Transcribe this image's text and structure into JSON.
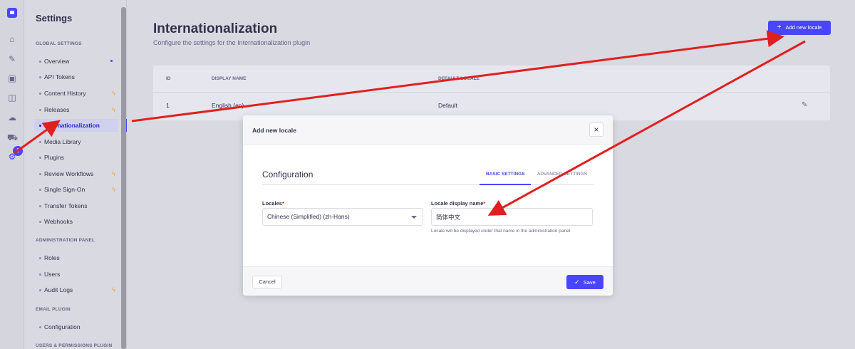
{
  "rail": {
    "badge": "1"
  },
  "sidebar": {
    "title": "Settings",
    "sections": {
      "global": "GLOBAL SETTINGS",
      "admin": "ADMINISTRATION PANEL",
      "email": "EMAIL PLUGIN",
      "users": "USERS & PERMISSIONS PLUGIN"
    },
    "global_items": [
      {
        "label": "Overview"
      },
      {
        "label": "API Tokens"
      },
      {
        "label": "Content History"
      },
      {
        "label": "Releases"
      },
      {
        "label": "Internationalization"
      },
      {
        "label": "Media Library"
      },
      {
        "label": "Plugins"
      },
      {
        "label": "Review Workflows"
      },
      {
        "label": "Single Sign-On"
      },
      {
        "label": "Transfer Tokens"
      },
      {
        "label": "Webhooks"
      }
    ],
    "admin_items": [
      {
        "label": "Roles"
      },
      {
        "label": "Users"
      },
      {
        "label": "Audit Logs"
      }
    ],
    "email_items": [
      {
        "label": "Configuration"
      }
    ]
  },
  "main": {
    "title": "Internationalization",
    "subtitle": "Configure the settings for the Internationalization plugin",
    "add_button": "Add new locale",
    "table": {
      "headers": [
        "ID",
        "DISPLAY NAME",
        "DEFAULT LOCALE"
      ],
      "rows": [
        {
          "id": "1",
          "display_name": "English (en)",
          "default_locale": "Default"
        }
      ]
    }
  },
  "modal": {
    "title": "Add new locale",
    "section_title": "Configuration",
    "tabs": [
      "BASIC SETTINGS",
      "ADVANCED SETTINGS"
    ],
    "locales_label": "Locales",
    "locales_value": "Chinese (Simplified) (zh-Hans)",
    "display_name_label": "Locale display name",
    "display_name_value": "简体中文",
    "hint": "Locale will be displayed under that name in the administration panel",
    "cancel": "Cancel",
    "save": "Save"
  },
  "colors": {
    "primary": "#4945ff",
    "annotation": "#e02020",
    "warning": "#f29d41"
  }
}
